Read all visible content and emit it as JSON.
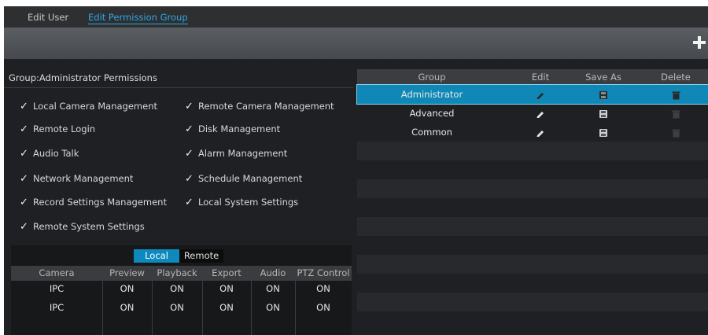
{
  "tabs": {
    "edit_user": "Edit User",
    "edit_permission_group": "Edit Permission Group"
  },
  "toolbar": {
    "add_icon": "plus-icon"
  },
  "group_title": "Group:Administrator Permissions",
  "permissions": [
    {
      "label": "Local Camera Management",
      "checked": true
    },
    {
      "label": "Remote Camera Management",
      "checked": true
    },
    {
      "label": "Remote Login",
      "checked": true
    },
    {
      "label": "Disk Management",
      "checked": true
    },
    {
      "label": "Audio Talk",
      "checked": true
    },
    {
      "label": "Alarm Management",
      "checked": true
    },
    {
      "label": "Network Management",
      "checked": true
    },
    {
      "label": "Schedule Management",
      "checked": true
    },
    {
      "label": "Record Settings Management",
      "checked": true
    },
    {
      "label": "Local System Settings",
      "checked": true
    },
    {
      "label": "Remote System Settings",
      "checked": true
    }
  ],
  "check_glyph": "✓",
  "camera_table": {
    "segments": {
      "local": "Local",
      "remote": "Remote",
      "active": "local"
    },
    "headers": [
      "Camera",
      "Preview",
      "Playback",
      "Export",
      "Audio",
      "PTZ Control"
    ],
    "rows": [
      [
        "IPC",
        "ON",
        "ON",
        "ON",
        "ON",
        "ON"
      ],
      [
        "IPC",
        "ON",
        "ON",
        "ON",
        "ON",
        "ON"
      ]
    ]
  },
  "group_table": {
    "headers": {
      "group": "Group",
      "edit": "Edit",
      "save_as": "Save As",
      "delete": "Delete"
    },
    "rows": [
      {
        "name": "Administrator",
        "selected": true,
        "delete_enabled": true
      },
      {
        "name": "Advanced",
        "selected": false,
        "delete_enabled": false
      },
      {
        "name": "Common",
        "selected": false,
        "delete_enabled": false
      }
    ]
  },
  "colors": {
    "accent": "#0f88b8",
    "link": "#2fa8e6",
    "background": "#1f2023"
  }
}
